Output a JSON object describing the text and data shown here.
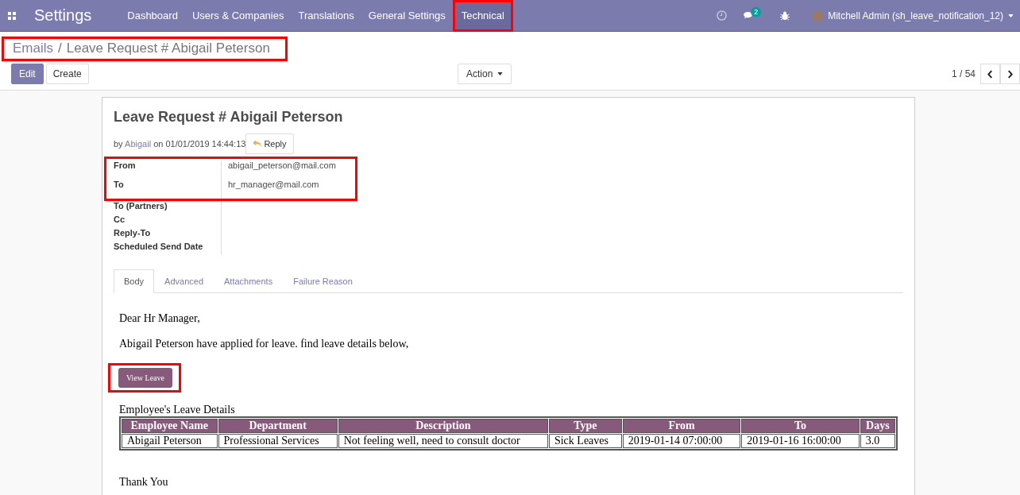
{
  "navbar": {
    "app_title": "Settings",
    "menu": [
      {
        "label": "Dashboard",
        "selected": false,
        "highlighted": false
      },
      {
        "label": "Users & Companies",
        "selected": false,
        "highlighted": false
      },
      {
        "label": "Translations",
        "selected": false,
        "highlighted": false
      },
      {
        "label": "General Settings",
        "selected": false,
        "highlighted": false
      },
      {
        "label": "Technical",
        "selected": true,
        "highlighted": true
      }
    ],
    "message_count": "2",
    "user": "Mitchell Admin (sh_leave_notification_12)"
  },
  "breadcrumb": {
    "highlighted": true,
    "separator": "/",
    "items": [
      "Emails",
      "Leave Request # Abigail Peterson"
    ]
  },
  "buttons": {
    "edit": "Edit",
    "create": "Create",
    "action": "Action"
  },
  "pager": "1 / 54",
  "email": {
    "subject": "Leave Request # Abigail Peterson",
    "by_prefix": "by",
    "author": "Abigail",
    "date": "on 01/01/2019 14:44:13",
    "reply": "Reply",
    "address_fields": {
      "highlighted": true,
      "rows": [
        {
          "label": "From",
          "value": "abigail_peterson@mail.com"
        },
        {
          "label": "To",
          "value": "hr_manager@mail.com"
        }
      ]
    },
    "other_fields": [
      "To (Partners)",
      "Cc",
      "Reply-To",
      "Scheduled Send Date"
    ],
    "tabs": [
      {
        "label": "Body",
        "selected": true
      },
      {
        "label": "Advanced",
        "selected": false
      },
      {
        "label": "Attachments",
        "selected": false
      },
      {
        "label": "Failure Reason",
        "selected": false
      }
    ],
    "body": {
      "greeting": "Dear Hr Manager,",
      "intro": "Abigail Peterson have applied for leave. find leave details below,",
      "view_button": {
        "label": "View Leave",
        "highlighted": true
      },
      "table_caption": "Employee's Leave Details",
      "table": {
        "columns": [
          "Employee Name",
          "Department",
          "Description",
          "Type",
          "From",
          "To",
          "Days"
        ],
        "rows": [
          [
            "Abigail Peterson",
            "Professional Services",
            "Not feeling well, need to consult doctor",
            "Sick Leaves",
            "2019-01-14 07:00:00",
            "2019-01-16 16:00:00",
            "3.0"
          ]
        ]
      },
      "closing": "Thank You"
    }
  }
}
